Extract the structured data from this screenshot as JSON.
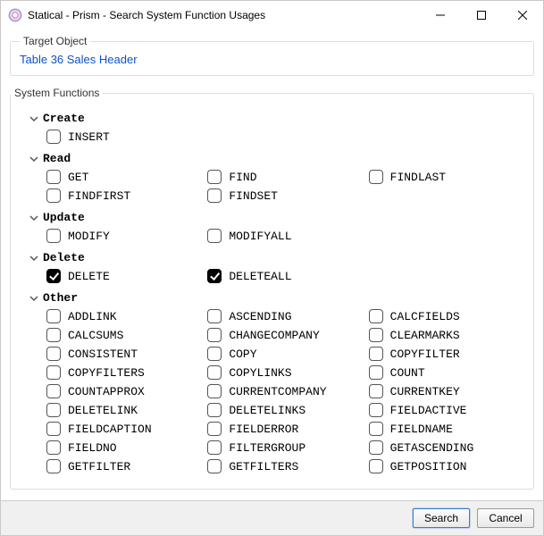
{
  "window": {
    "title": "Statical - Prism - Search System Function Usages"
  },
  "target": {
    "legend": "Target Object",
    "link_text": "Table 36 Sales Header"
  },
  "functions_legend": "System Functions",
  "categories": [
    {
      "name": "Create",
      "single_column": true,
      "items": [
        {
          "label": "INSERT",
          "checked": false
        }
      ]
    },
    {
      "name": "Read",
      "items": [
        {
          "label": "GET",
          "checked": false
        },
        {
          "label": "FIND",
          "checked": false
        },
        {
          "label": "FINDLAST",
          "checked": false
        },
        {
          "label": "FINDFIRST",
          "checked": false
        },
        {
          "label": "FINDSET",
          "checked": false
        }
      ]
    },
    {
      "name": "Update",
      "items": [
        {
          "label": "MODIFY",
          "checked": false
        },
        {
          "label": "MODIFYALL",
          "checked": false
        }
      ]
    },
    {
      "name": "Delete",
      "items": [
        {
          "label": "DELETE",
          "checked": true
        },
        {
          "label": "DELETEALL",
          "checked": true
        }
      ]
    },
    {
      "name": "Other",
      "items": [
        {
          "label": "ADDLINK",
          "checked": false
        },
        {
          "label": "ASCENDING",
          "checked": false
        },
        {
          "label": "CALCFIELDS",
          "checked": false
        },
        {
          "label": "CALCSUMS",
          "checked": false
        },
        {
          "label": "CHANGECOMPANY",
          "checked": false
        },
        {
          "label": "CLEARMARKS",
          "checked": false
        },
        {
          "label": "CONSISTENT",
          "checked": false
        },
        {
          "label": "COPY",
          "checked": false
        },
        {
          "label": "COPYFILTER",
          "checked": false
        },
        {
          "label": "COPYFILTERS",
          "checked": false
        },
        {
          "label": "COPYLINKS",
          "checked": false
        },
        {
          "label": "COUNT",
          "checked": false
        },
        {
          "label": "COUNTAPPROX",
          "checked": false
        },
        {
          "label": "CURRENTCOMPANY",
          "checked": false
        },
        {
          "label": "CURRENTKEY",
          "checked": false
        },
        {
          "label": "DELETELINK",
          "checked": false
        },
        {
          "label": "DELETELINKS",
          "checked": false
        },
        {
          "label": "FIELDACTIVE",
          "checked": false
        },
        {
          "label": "FIELDCAPTION",
          "checked": false
        },
        {
          "label": "FIELDERROR",
          "checked": false
        },
        {
          "label": "FIELDNAME",
          "checked": false
        },
        {
          "label": "FIELDNO",
          "checked": false
        },
        {
          "label": "FILTERGROUP",
          "checked": false
        },
        {
          "label": "GETASCENDING",
          "checked": false
        },
        {
          "label": "GETFILTER",
          "checked": false
        },
        {
          "label": "GETFILTERS",
          "checked": false
        },
        {
          "label": "GETPOSITION",
          "checked": false
        }
      ]
    }
  ],
  "buttons": {
    "search": "Search",
    "cancel": "Cancel"
  }
}
